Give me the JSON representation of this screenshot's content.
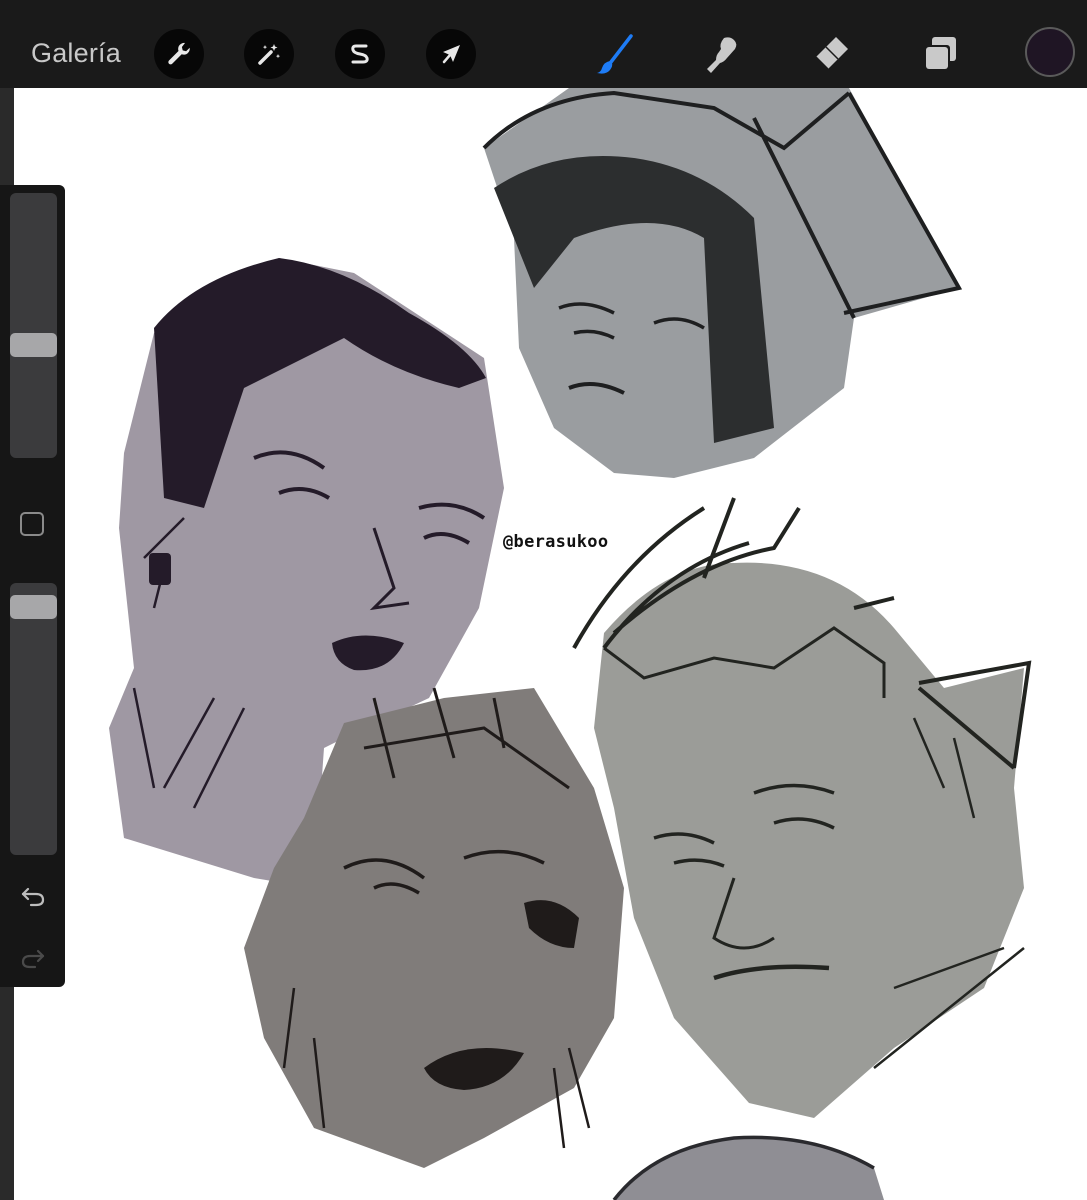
{
  "toolbar": {
    "gallery_label": "Galería",
    "actions_icon": "wrench-icon",
    "adjustments_icon": "magic-wand-icon",
    "selection_icon": "selection-s-icon",
    "transform_icon": "arrow-cursor-icon",
    "brush_icon": "brush-icon",
    "smudge_icon": "smudge-finger-icon",
    "eraser_icon": "eraser-icon",
    "layers_icon": "layers-icon",
    "active_tool": "brush",
    "active_color": "#1f1524",
    "brush_accent": "#1e7cf6"
  },
  "sidebar": {
    "brush_size_level": 0.42,
    "opacity_level": 0.05,
    "undo_icon": "undo-icon",
    "redo_icon": "redo-icon"
  },
  "canvas": {
    "watermark": "@berasukoo"
  }
}
